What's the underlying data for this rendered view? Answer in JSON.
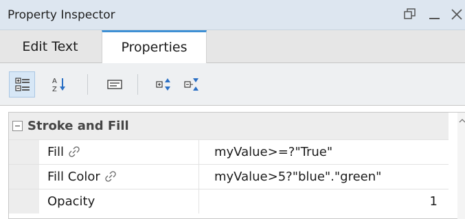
{
  "window": {
    "title": "Property Inspector",
    "controls": [
      "restore-icon",
      "minimize-icon",
      "close-icon"
    ]
  },
  "tabs": [
    {
      "label": "Edit Text",
      "active": false
    },
    {
      "label": "Properties",
      "active": true
    }
  ],
  "toolbar": {
    "buttons": [
      "categorized-icon",
      "alphabetical-sort-icon",
      "description-icon",
      "expand-all-icon",
      "collapse-all-icon"
    ],
    "active_button": "categorized-icon"
  },
  "grid": {
    "category": "Stroke and Fill",
    "rows": [
      {
        "name": "Fill",
        "value": "myValue>=?\"True\"",
        "bound": true
      },
      {
        "name": "Fill Color",
        "value": "myValue>5?\"blue\".\"green\"",
        "bound": true
      },
      {
        "name": "Opacity",
        "value": "1",
        "bound": false
      }
    ]
  },
  "colors": {
    "titlebar": "#dde6f0",
    "active_tab_accent": "#3d8fd4",
    "toolbar_active": "#d7e7f6"
  }
}
